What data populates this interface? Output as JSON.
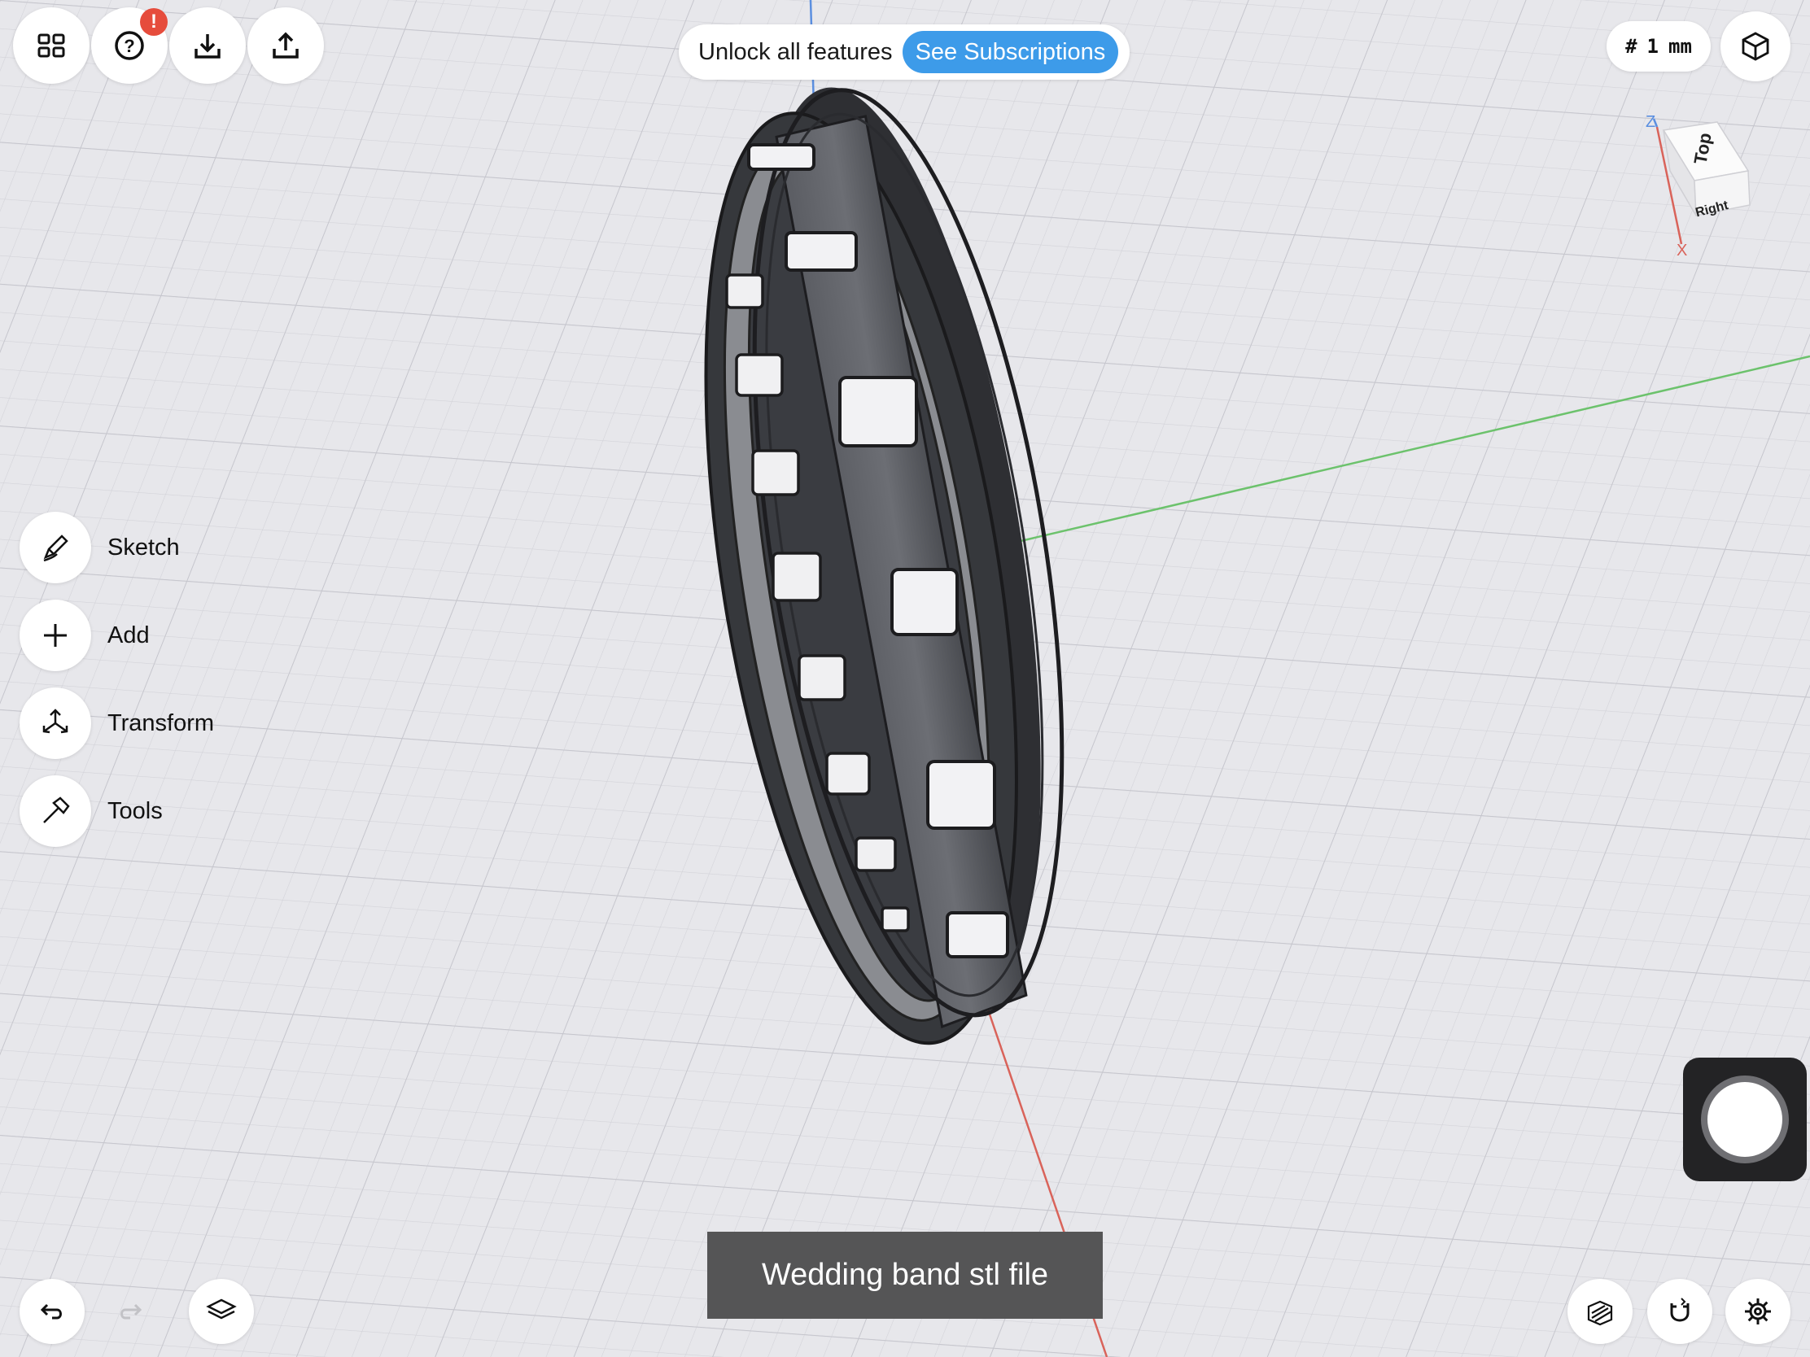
{
  "toolbar": {
    "apps_icon": "grid-apps-icon",
    "help_icon": "help-icon",
    "help_badge": "!",
    "download_icon": "download-icon",
    "share_icon": "share-icon"
  },
  "banner": {
    "text": "Unlock all features",
    "button_label": "See Subscriptions"
  },
  "grid_unit": {
    "symbol": "#",
    "value": "1",
    "unit": "mm"
  },
  "view_cube": {
    "top_label": "Top",
    "right_label": "Right",
    "z_label": "Z",
    "x_label": "X"
  },
  "menu": {
    "items": [
      {
        "label": "Sketch",
        "icon": "pencil-icon"
      },
      {
        "label": "Add",
        "icon": "plus-icon"
      },
      {
        "label": "Transform",
        "icon": "transform-arrows-icon"
      },
      {
        "label": "Tools",
        "icon": "hammer-icon"
      }
    ]
  },
  "caption": "Wedding band stl file",
  "colors": {
    "accent": "#3d9be9",
    "badge": "#e64c3c",
    "axis_x": "#d9635a",
    "axis_y": "#6cc26c",
    "axis_z": "#5b8fe0",
    "model": "#3f4146"
  },
  "bottom": {
    "undo_icon": "undo-icon",
    "redo_icon": "redo-icon",
    "layers_icon": "layers-icon",
    "section_icon": "section-view-icon",
    "snap_icon": "magnet-icon",
    "settings_icon": "gear-icon"
  }
}
